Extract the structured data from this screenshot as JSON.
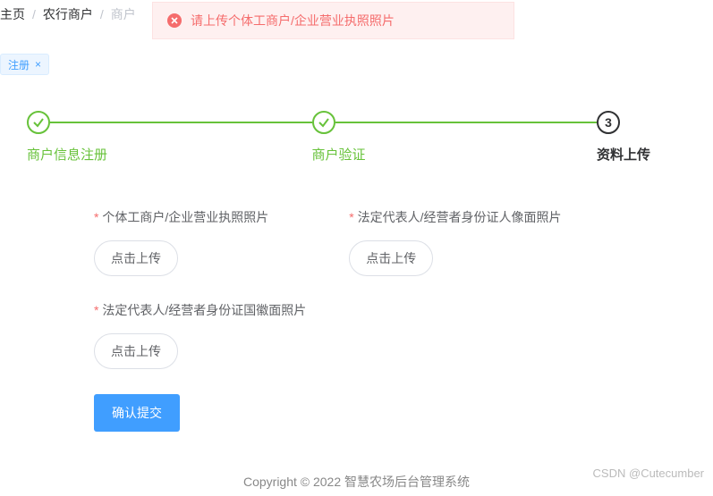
{
  "breadcrumb": {
    "items": [
      "主页",
      "农行商户",
      "商户"
    ]
  },
  "alert": {
    "message": "请上传个体工商户/企业营业执照照片"
  },
  "tag": {
    "label": "注册"
  },
  "steps": {
    "items": [
      {
        "title": "商户信息注册",
        "status": "done"
      },
      {
        "title": "商户验证",
        "status": "done"
      },
      {
        "title": "资料上传",
        "status": "active",
        "number": "3"
      }
    ]
  },
  "form": {
    "fields": {
      "license": {
        "label": "个体工商户/企业营业执照照片",
        "button": "点击上传"
      },
      "id_front": {
        "label": "法定代表人/经营者身份证人像面照片",
        "button": "点击上传"
      },
      "id_back": {
        "label": "法定代表人/经营者身份证国徽面照片",
        "button": "点击上传"
      }
    },
    "submit": "确认提交"
  },
  "footer": {
    "copyright": "Copyright © 2022 智慧农场后台管理系统"
  },
  "watermark": "CSDN @Cutecumber"
}
